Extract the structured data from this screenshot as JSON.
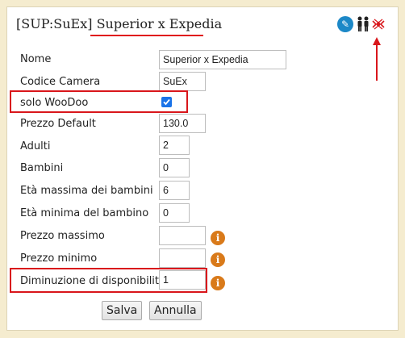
{
  "header": {
    "code": "[SUP:SuEx]",
    "name": "Superior x Expedia",
    "icons": [
      "edit-icon",
      "people-icon",
      "bed-icon"
    ]
  },
  "form": {
    "nome": {
      "label": "Nome",
      "value": "Superior x Expedia"
    },
    "codice_camera": {
      "label": "Codice Camera",
      "value": "SuEx"
    },
    "solo_woodoo": {
      "label": "solo WooDoo",
      "checked": true
    },
    "prezzo_default": {
      "label": "Prezzo Default",
      "value": "130.0"
    },
    "adulti": {
      "label": "Adulti",
      "value": "2"
    },
    "bambini": {
      "label": "Bambini",
      "value": "0"
    },
    "eta_massima_bambini": {
      "label": "Età massima dei bambini",
      "value": "6"
    },
    "eta_minima_bambino": {
      "label": "Età minima del bambino",
      "value": "0"
    },
    "prezzo_massimo": {
      "label": "Prezzo massimo",
      "value": ""
    },
    "prezzo_minimo": {
      "label": "Prezzo minimo",
      "value": ""
    },
    "diminuzione_disponibilita": {
      "label": "Diminuzione di disponibilità",
      "value": "1"
    }
  },
  "info_glyph": "i",
  "buttons": {
    "save": "Salva",
    "cancel": "Annulla"
  },
  "colors": {
    "highlight": "#d9161b",
    "checkbox": "#1a73e8",
    "info": "#d97a1a",
    "edit": "#1c88c7"
  }
}
